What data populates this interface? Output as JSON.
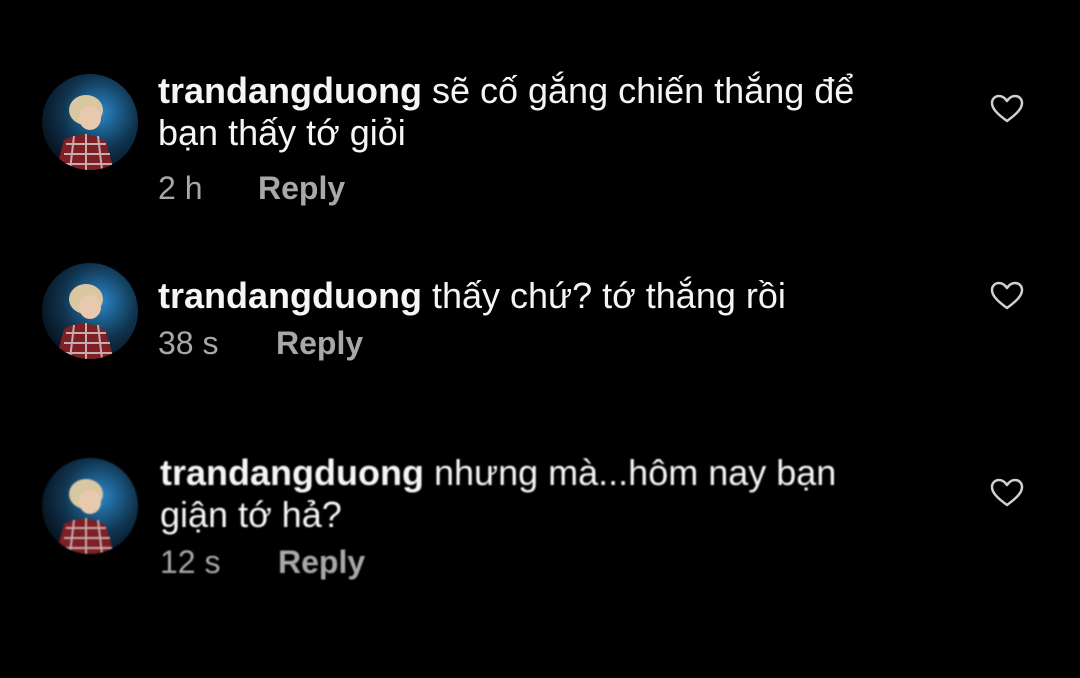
{
  "comments": [
    {
      "username": "trandangduong",
      "text": "sẽ cố gắng chiến thắng để bạn thấy tớ giỏi",
      "time": "2 h",
      "reply_label": "Reply"
    },
    {
      "username": "trandangduong",
      "text": "thấy chứ? tớ thắng rồi",
      "time": "38 s",
      "reply_label": "Reply"
    },
    {
      "username": "trandangduong",
      "text": "nhưng mà...hôm nay bạn giận tớ hả?",
      "time": "12 s",
      "reply_label": "Reply"
    }
  ],
  "icons": {
    "like": "heart-outline-icon",
    "avatar": "user-avatar-photo"
  },
  "colors": {
    "background": "#000000",
    "text": "#f5f5f5",
    "secondary": "#a8a8a8",
    "heart_stroke": "#d0d0d0"
  }
}
